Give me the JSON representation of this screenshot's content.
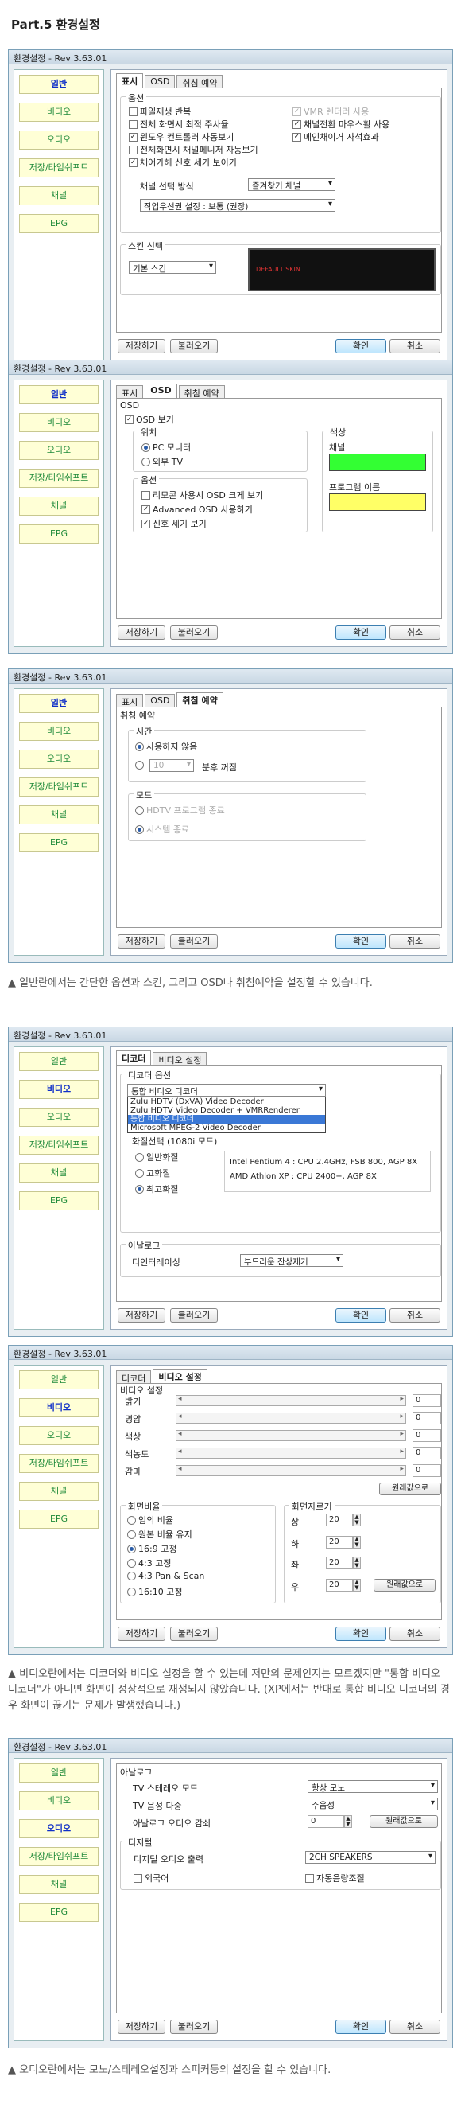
{
  "part_title": "Part.5 환경설정",
  "window_title": "환경설정 - Rev  3.63.01",
  "nav": [
    "일반",
    "비디오",
    "오디오",
    "저장/타임쉬프트",
    "채널",
    "EPG"
  ],
  "buttons": {
    "save": "저장하기",
    "load": "불러오기",
    "ok": "확인",
    "cancel": "취소",
    "reset": "원래값으로"
  },
  "general_tabs": [
    "표시",
    "OSD",
    "취침 예약"
  ],
  "shot1": {
    "options_label": "옵션",
    "checks": [
      {
        "label": "파일재생 반복",
        "checked": false
      },
      {
        "label": "VMR 렌더러 사용",
        "checked": true,
        "dim": true
      },
      {
        "label": "전체 화면시 최적 주사율",
        "checked": false
      },
      {
        "label": "채널전환 마우스휠 사용",
        "checked": true
      },
      {
        "label": "윈도우 컨트롤러 자동보기",
        "checked": true
      },
      {
        "label": "메인채이거 자석효과",
        "checked": true
      },
      {
        "label": "전체화면시 채널페니저 자동보기",
        "checked": false
      },
      {
        "label": "채어가해 신호 세기 보이기",
        "checked": true
      }
    ],
    "channel_method_label": "채널 선택 방식",
    "channel_method_value": "즐겨찾기 채널",
    "priority_value": "작업우선권 설정 : 보통 (권장)",
    "skin_label": "스킨 선택",
    "skin_value": "기본 스킨",
    "skin_preview": "DEFAULT SKIN"
  },
  "shot2": {
    "osd_label": "OSD",
    "osd_show": "OSD 보기",
    "position_label": "위치",
    "pos_pc": "PC 모니터",
    "pos_tv": "외부 TV",
    "options_label": "옵션",
    "opt1": "리모콘 사용시 OSD 크게 보기",
    "opt2": "Advanced OSD 사용하기",
    "opt3": "신호 세기 보기",
    "color_label": "색상",
    "channel_label": "채널",
    "program_label": "프로그램 이름",
    "channel_color": "#33ff33",
    "program_color": "#ffff66"
  },
  "shot3": {
    "sleep_label": "취침 예약",
    "time_label": "시간",
    "no_use": "사용하지 않음",
    "minutes_value": "10",
    "minutes_after": "분후 꺼짐",
    "mode_label": "모드",
    "mode_hdtv": "HDTV 프로그램 종료",
    "mode_system": "시스템 종료"
  },
  "video_tabs": [
    "디코더",
    "비디오 설정"
  ],
  "shot4": {
    "decoder_option": "디코더 옵션",
    "decoder_value": "통합 비디오 디코더",
    "decoder_list": [
      "Zulu HDTV (DxVA) Video Decoder",
      "Zulu HDTV Video Decoder + VMRRenderer",
      "통합 비디오 디코더",
      "Microsoft MPEG-2 Video Decoder"
    ],
    "quality_label": "화질선택 (1080i 모드)",
    "q_normal": "일반화질",
    "q_high": "고화질",
    "q_best": "최고화질",
    "spec1": "Intel Pentium 4 : CPU 2.4GHz, FSB 800, AGP 8X",
    "spec2": "AMD Athlon XP : CPU 2400+, AGP 8X",
    "analog_label": "아날로그",
    "deinterlace_label": "디인터레이싱",
    "deinterlace_value": "부드러운 잔상제거"
  },
  "shot5": {
    "video_setting": "비디오 설정",
    "sliders": [
      "밝기",
      "명암",
      "색상",
      "색농도",
      "감마"
    ],
    "slider_values": [
      "0",
      "0",
      "0",
      "0",
      "0"
    ],
    "ratio_label": "화면비율",
    "ratios": [
      "임의 비율",
      "원본 비율 유지",
      "16:9 고정",
      "4:3 고정",
      "4:3 Pan & Scan",
      "16:10 고정"
    ],
    "crop_label": "화면자르기",
    "crop": [
      {
        "k": "상",
        "v": "20"
      },
      {
        "k": "하",
        "v": "20"
      },
      {
        "k": "좌",
        "v": "20"
      },
      {
        "k": "우",
        "v": "20"
      }
    ]
  },
  "shot6": {
    "analog_label": "아날로그",
    "tv_stereo_label": "TV 스테레오 모드",
    "tv_stereo_value": "항상 모노",
    "tv_voice_label": "TV 음성 다중",
    "tv_voice_value": "주음성",
    "analog_volume_label": "아날로그 오디오 감쇠",
    "analog_volume_value": "0",
    "digital_label": "디지털",
    "digital_out_label": "디지털 오디오 출력",
    "digital_out_value": "2CH SPEAKERS",
    "foreign": "외국어",
    "auto_volume": "자동음량조절"
  },
  "captions": {
    "c1": "▲ 일반란에서는 간단한 옵션과 스킨, 그리고 OSD나 취침예약을 설정할 수 있습니다.",
    "c2": "▲ 비디오란에서는 디코더와 비디오 설정을 할 수 있는데 저만의 문제인지는 모르겠지만 \"통합 비디오 디코더\"가 아니면 화면이 정상적으로 재생되지 않았습니다. (XP에서는 반대로 통합 비디오 디코더의 경우 화면이 끊기는 문제가 발생했습니다.)",
    "c3": "▲ 오디오란에서는 모노/스테레오설정과 스피커등의 설정을 할 수 있습니다."
  }
}
